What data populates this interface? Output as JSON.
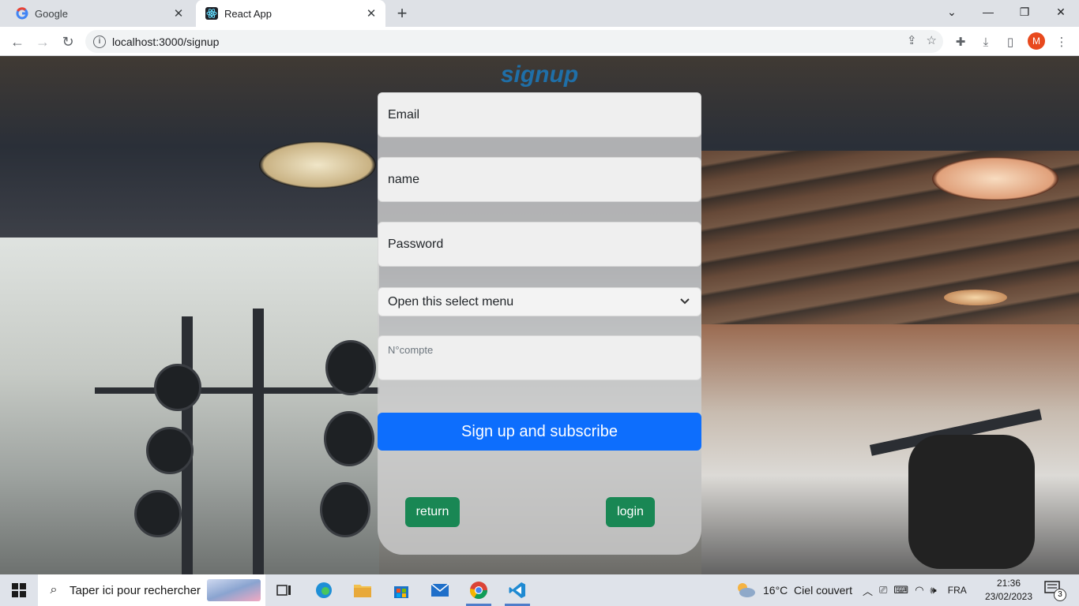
{
  "browser": {
    "tabs": [
      {
        "title": "Google",
        "icon": "google-icon",
        "active": false
      },
      {
        "title": "React App",
        "icon": "react-icon",
        "active": true
      }
    ],
    "url": "localhost:3000/signup",
    "profile_initial": "M"
  },
  "page": {
    "title": "signup",
    "fields": {
      "email_label": "Email",
      "name_label": "name",
      "password_label": "Password",
      "select_value": "Open this select menu",
      "account_placeholder": "N°compte"
    },
    "submit_label": "Sign up and subscribe",
    "return_label": "return",
    "login_label": "login",
    "colors": {
      "title": "#1f6fa8",
      "primary": "#0d6efd",
      "success": "#198754"
    }
  },
  "taskbar": {
    "search_placeholder": "Taper ici pour rechercher",
    "weather": "16°C  Ciel couvert",
    "language": "FRA",
    "time": "21:36",
    "date": "23/02/2023",
    "notification_count": "3"
  }
}
